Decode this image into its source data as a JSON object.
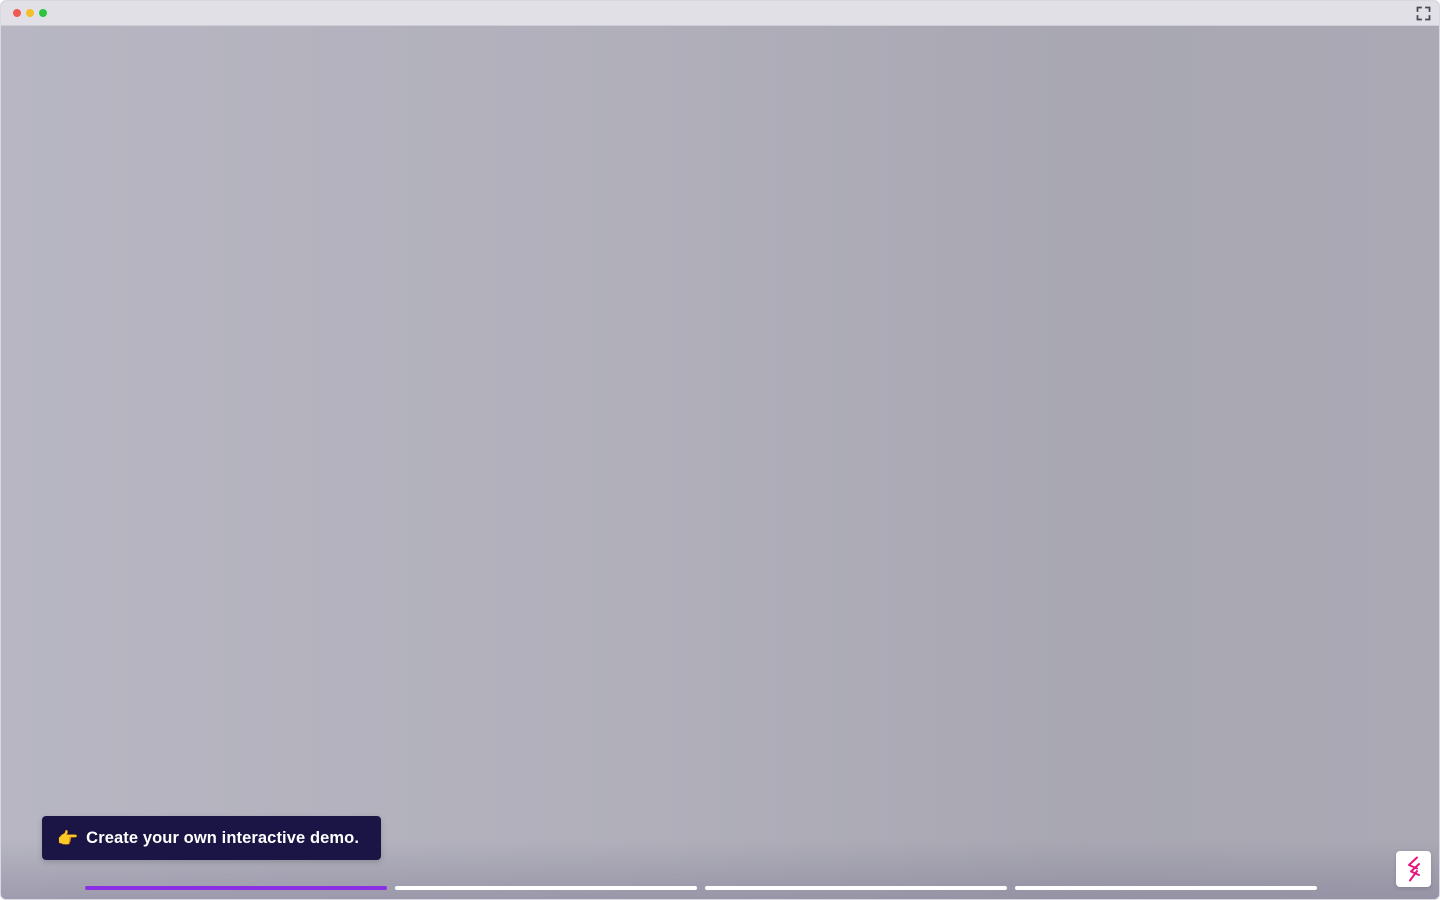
{
  "cta": {
    "emoji": "👉",
    "text": "Create your own interactive demo."
  },
  "progress": {
    "steps": 4,
    "active_step": 1,
    "active_color": "#8b2fe3",
    "inactive_color": "#ffffff"
  },
  "colors": {
    "close": "#ee5a52",
    "minimize": "#f5be2e",
    "zoom": "#2dc43f",
    "cta_background": "#1b1545",
    "logo_accent": "#e6157d"
  },
  "icons": {
    "fullscreen": "fullscreen-icon",
    "logo": "storylane-logo-icon"
  }
}
